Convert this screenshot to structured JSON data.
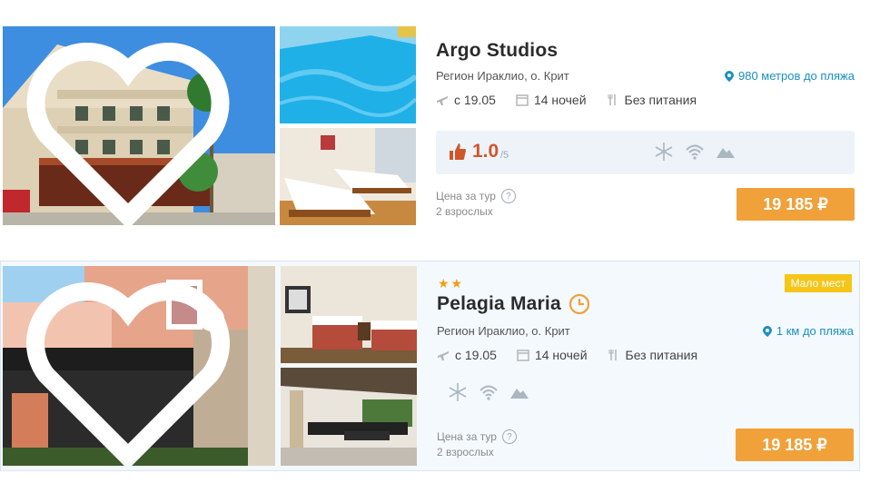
{
  "hotels": [
    {
      "name": "Argo Studios",
      "stars": "",
      "badge": "",
      "region": "Регион Ираклио, о. Крит",
      "beach_distance": "980 метров до пляжа",
      "date": "с 19.05",
      "nights": "14 ночей",
      "meals": "Без питания",
      "rating": "1.0",
      "rating_max": "/5",
      "price_label": "Цена за тур",
      "guests": "2 взрослых",
      "price": "19 185 ₽",
      "amenities": [
        "snowflake-icon",
        "wifi-icon",
        "mountain-icon"
      ]
    },
    {
      "name": "Pelagia Maria",
      "stars": "★★",
      "badge": "Мало мест",
      "region": "Регион Ираклио, о. Крит",
      "beach_distance": "1 км до пляжа",
      "date": "с 19.05",
      "nights": "14 ночей",
      "meals": "Без питания",
      "price_label": "Цена за тур",
      "guests": "2 взрослых",
      "price": "19 185 ₽",
      "amenities": [
        "snowflake-icon",
        "wifi-icon",
        "mountain-icon"
      ]
    }
  ],
  "colors": {
    "accent_orange": "#f0a13a",
    "rating_red": "#d0552b",
    "link_blue": "#1a8fc1",
    "badge_yellow": "#f5c518"
  }
}
